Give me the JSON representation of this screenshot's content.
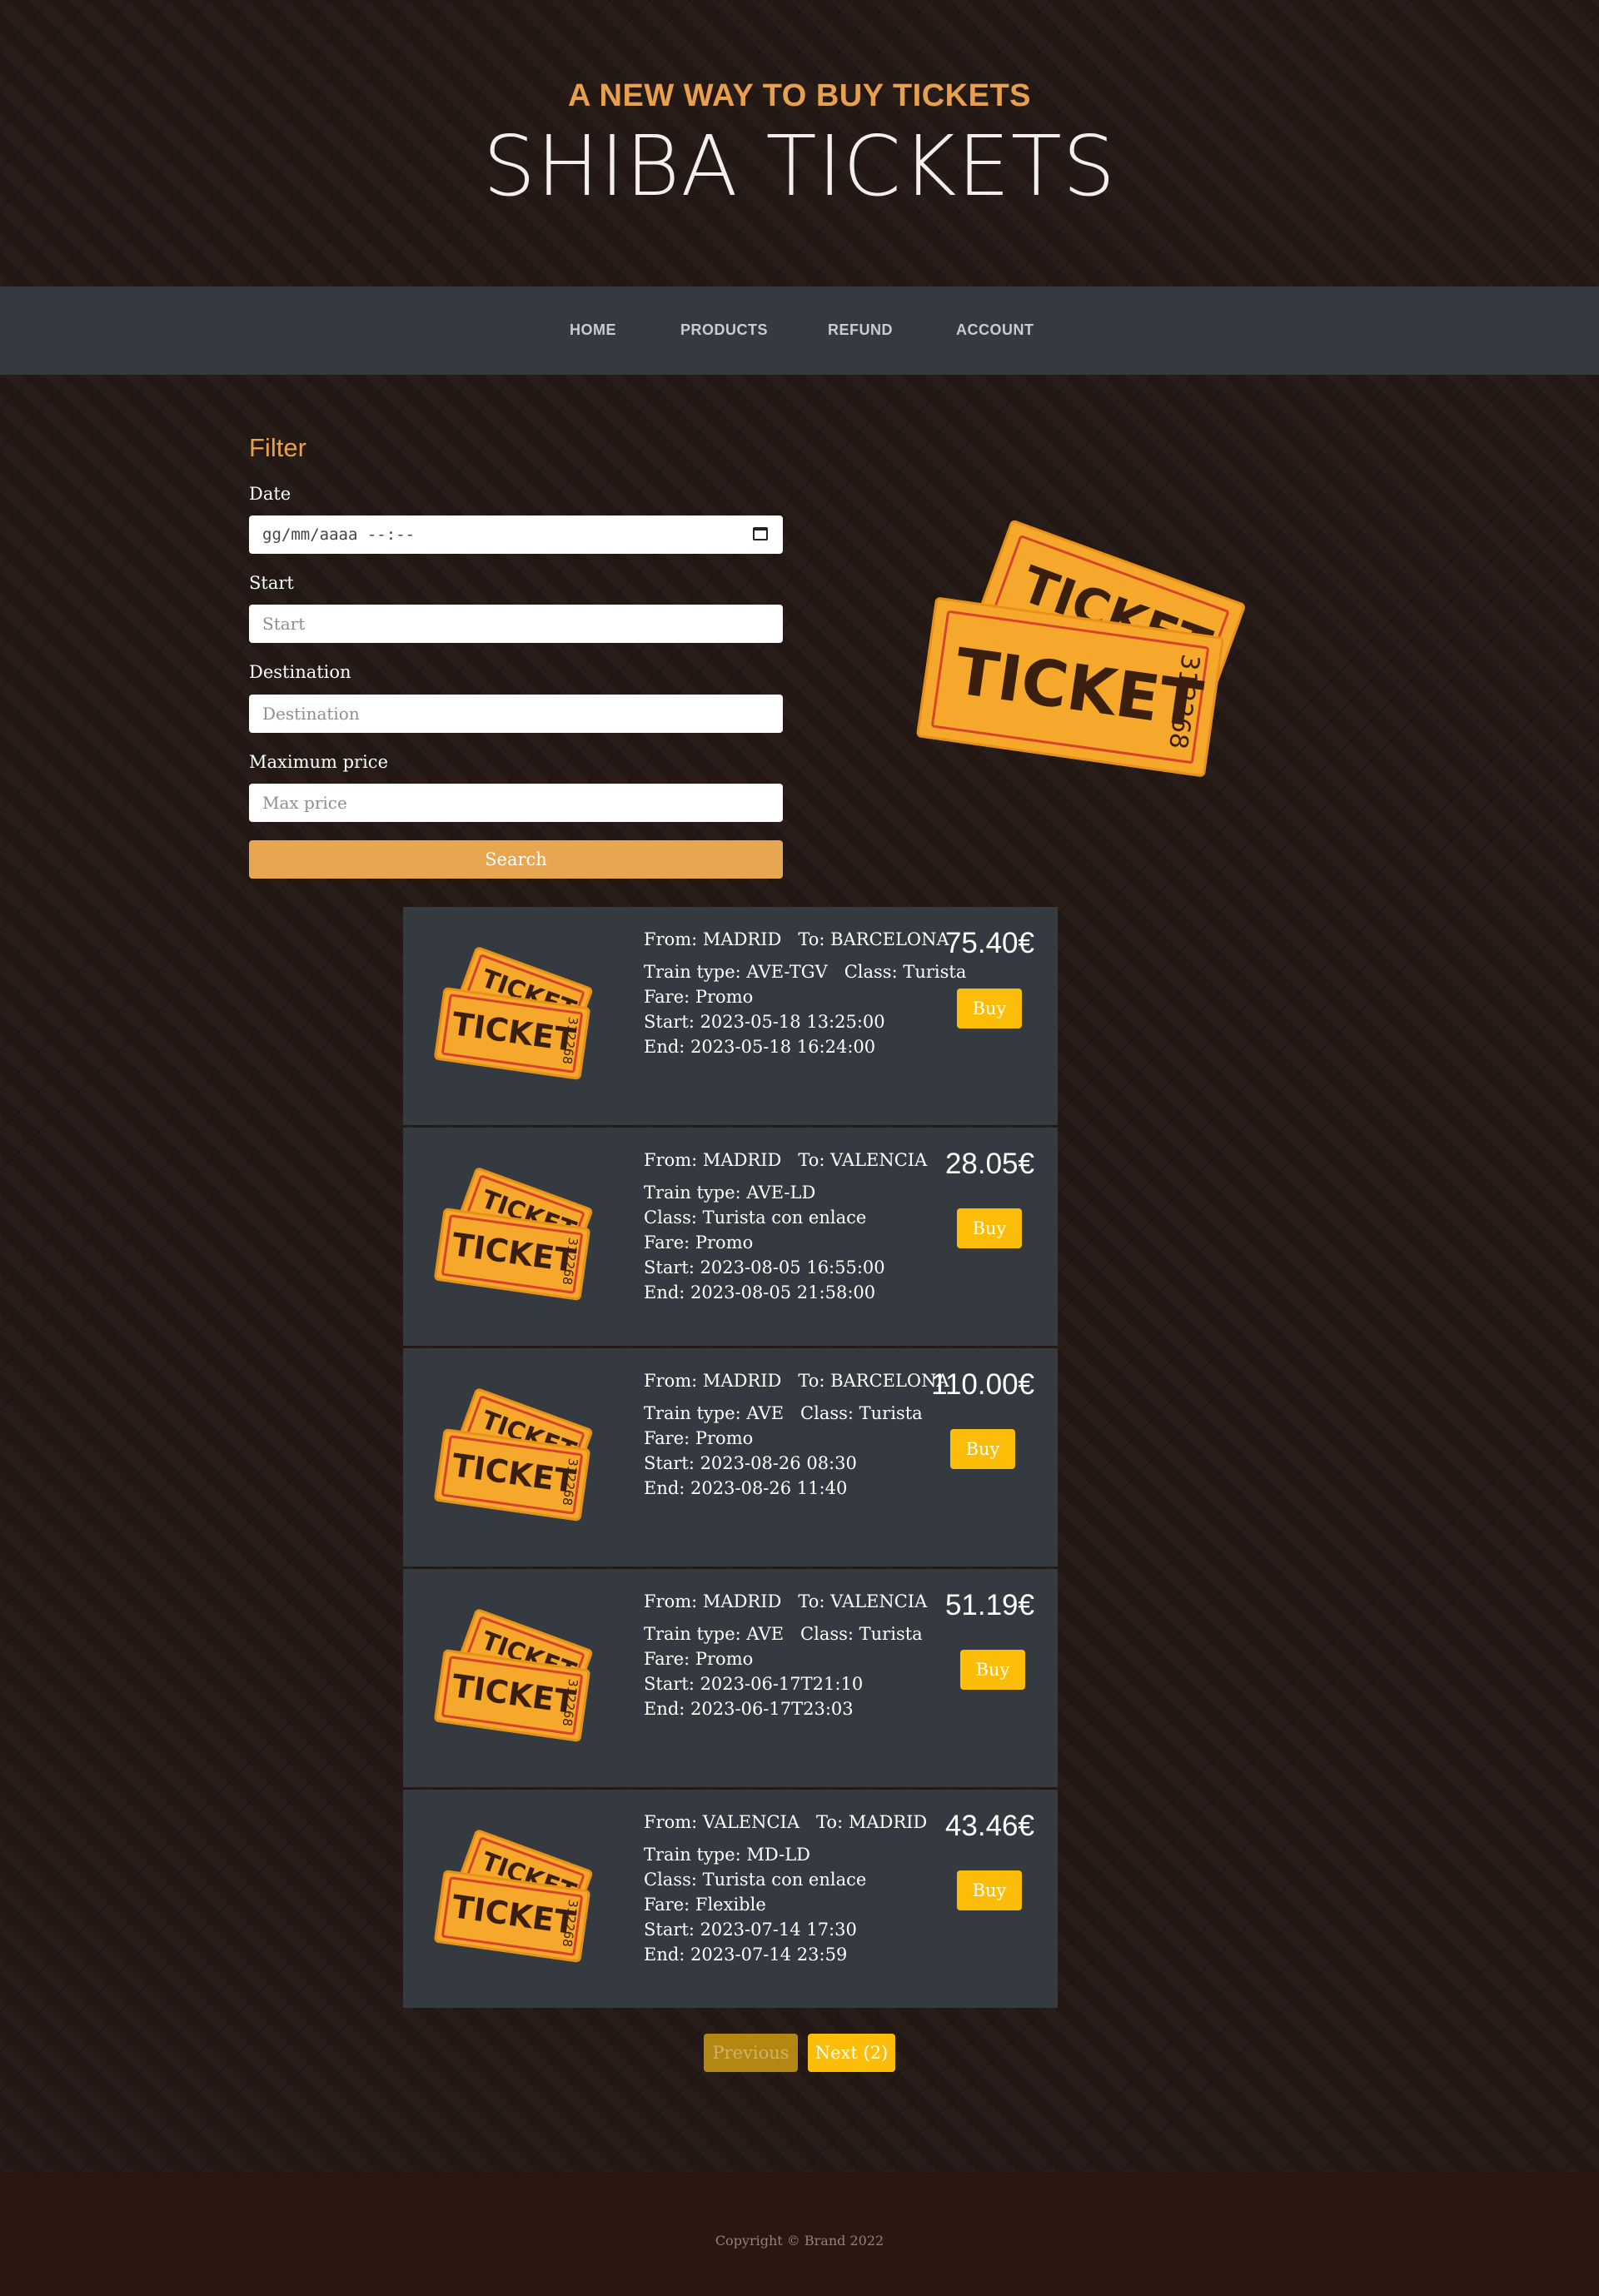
{
  "header": {
    "tagline": "A NEW WAY TO BUY TICKETS",
    "brand": "SHIBA TICKETS"
  },
  "nav": {
    "items": [
      "HOME",
      "PRODUCTS",
      "REFUND",
      "ACCOUNT"
    ]
  },
  "filter": {
    "title": "Filter",
    "date_label": "Date",
    "date_placeholder": "gg/mm/aaaa --:--",
    "start_label": "Start",
    "start_placeholder": "Start",
    "destination_label": "Destination",
    "destination_placeholder": "Destination",
    "max_price_label": "Maximum price",
    "max_price_placeholder": "Max price",
    "search_label": "Search"
  },
  "ticket_graphic": {
    "word": "TICKET",
    "number": "312268"
  },
  "results": [
    {
      "from": "From: MADRID",
      "to": "To: BARCELONA",
      "lines": [
        "Train type: AVE-TGV   Class: Turista",
        "Fare: Promo",
        "Start: 2023-05-18 13:25:00",
        "End: 2023-05-18 16:24:00"
      ],
      "price": "75.40€",
      "buy": "Buy"
    },
    {
      "from": "From: MADRID",
      "to": "To: VALENCIA",
      "lines": [
        "Train type: AVE-LD",
        "Class: Turista con enlace",
        "Fare: Promo",
        "Start: 2023-08-05 16:55:00",
        "End: 2023-08-05 21:58:00"
      ],
      "price": "28.05€",
      "buy": "Buy"
    },
    {
      "from": "From: MADRID",
      "to": "To: BARCELONA",
      "lines": [
        "Train type: AVE   Class: Turista",
        "Fare: Promo",
        "Start: 2023-08-26 08:30",
        "End: 2023-08-26 11:40"
      ],
      "price": "110.00€",
      "buy": "Buy"
    },
    {
      "from": "From: MADRID",
      "to": "To: VALENCIA",
      "lines": [
        "Train type: AVE   Class: Turista",
        "Fare: Promo",
        "Start: 2023-06-17T21:10",
        "End: 2023-06-17T23:03"
      ],
      "price": "51.19€",
      "buy": "Buy"
    },
    {
      "from": "From: VALENCIA",
      "to": "To: MADRID",
      "lines": [
        "Train type: MD-LD",
        "Class: Turista con enlace",
        "Fare: Flexible",
        "Start: 2023-07-14 17:30",
        "End: 2023-07-14 23:59"
      ],
      "price": "43.46€",
      "buy": "Buy"
    }
  ],
  "pagination": {
    "previous": "Previous",
    "next": "Next (2)"
  },
  "footer": {
    "copyright": "Copyright © Brand 2022"
  },
  "colors": {
    "accent": "#e8a04e",
    "buy": "#fbbd08",
    "nav": "#343a40",
    "card": "#343a40",
    "footer": "#2b1710"
  }
}
